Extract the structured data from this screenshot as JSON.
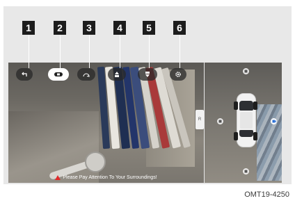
{
  "callouts": [
    "1",
    "2",
    "3",
    "4",
    "5",
    "6"
  ],
  "toolbar": [
    {
      "icon": "back-arrow-icon"
    },
    {
      "icon": "camera-view-icon",
      "active": true
    },
    {
      "icon": "panorama-rotate-icon"
    },
    {
      "icon": "front-camera-icon"
    },
    {
      "icon": "rear-camera-icon"
    },
    {
      "icon": "settings-gear-icon"
    }
  ],
  "main_view": {
    "warning_text": "Please Pay Attention To Your Surroundings!",
    "side_tab_label": "R"
  },
  "aerial_view": {
    "cameras": [
      "front-cam-icon",
      "left-cam-icon",
      "right-cam-icon",
      "rear-cam-icon"
    ],
    "active_camera": "right"
  },
  "caption": "OMT19-4250",
  "colors": {
    "callout_bg": "#1c1c1c",
    "warning_icon": "#e02a2a",
    "active_button": "#ffffff",
    "active_camera": "#2a6fd6"
  }
}
